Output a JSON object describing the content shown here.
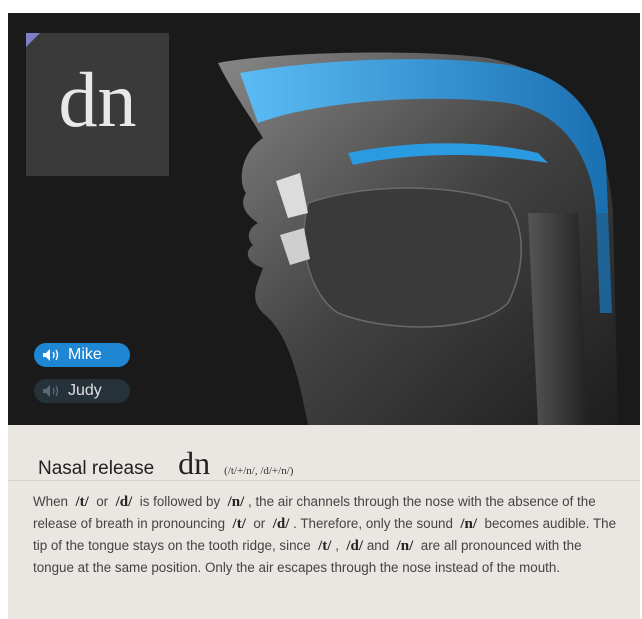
{
  "symbol_card": {
    "glyph": "dn"
  },
  "voices": [
    {
      "name": "Mike",
      "active": true,
      "icon": "speaker-icon"
    },
    {
      "name": "Judy",
      "active": false,
      "icon": "speaker-icon"
    }
  ],
  "info": {
    "title": "Nasal release",
    "symbol": "dn",
    "ipa": "(/t/+/n/, /d/+/n/)",
    "description": {
      "s1": "When",
      "p_t1": "/t/",
      "s2": "or",
      "p_d1": "/d/",
      "s3": "is followed by",
      "p_n1": "/n/",
      "s4": ", the air channels through the nose with the absence of the release of breath in pronouncing",
      "p_t2": "/t/",
      "s5": "or",
      "p_d2": "/d/",
      "s6": ". Therefore, only the sound",
      "p_n2": "/n/",
      "s7": "becomes audible. The tip of the tongue stays on the tooth ridge, since",
      "p_t3": "/t/",
      "s8": ",",
      "p_d3": "/d/",
      "s9": "and",
      "p_n3": "/n/",
      "s10": "are all pronounced with the tongue at the same position. Only the air escapes through the nose instead of the mouth."
    }
  },
  "colors": {
    "stage_bg": "#1a1a1a",
    "nasal_air": "#2a9be0",
    "active_button": "#1f86d4",
    "inactive_button": "#26323a",
    "info_bg": "#eae6e1"
  }
}
